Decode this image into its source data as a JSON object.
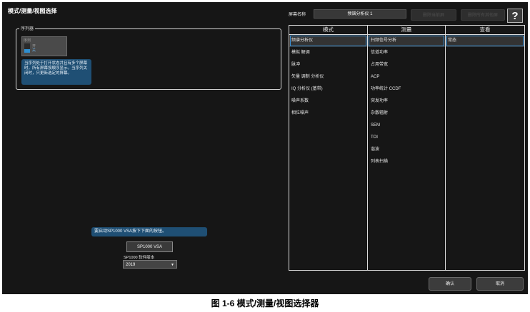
{
  "window": {
    "title": "模式/测量/视图选择"
  },
  "sequence": {
    "label": "序列器",
    "toggle_caption": "序列",
    "option_on": "开",
    "option_off": "关",
    "tip": "当序列处于打开状态并且有多个屏幕时，所有屏幕按顺序显示。当序列关闭时，只更新选定的屏幕。"
  },
  "screen": {
    "name_label": "屏幕名称",
    "name_value": "频谱分析仪 1",
    "delete_current": "删除当前屏",
    "delete_all_others": "删除所有其他屏",
    "help": "?"
  },
  "table": {
    "headers": [
      "模式",
      "测量",
      "查看"
    ],
    "modes": [
      "频谱分析仪",
      "模拟 解调",
      "脉冲",
      "矢量 调制 分析仪",
      "IQ 分析仪 (基带)",
      "噪声系数",
      "相位噪声"
    ],
    "measurements": [
      "扫频信号分析",
      "信道功率",
      "占用带宽",
      "ACP",
      "功率统计 CCDF",
      "突发功率",
      "杂散辐射",
      "SEM",
      "TOI",
      "谐波",
      "列表扫描"
    ],
    "views": [
      "常态"
    ]
  },
  "launch": {
    "info": "要启动SP1000 VSA按下下面的按钮。",
    "button": "SP1000 VSA",
    "version_label": "SP1000 软件版本",
    "version_value": "2019"
  },
  "footer": {
    "ok": "确认",
    "cancel": "取消"
  },
  "caption": "图 1-6 模式/测量/视图选择器"
}
